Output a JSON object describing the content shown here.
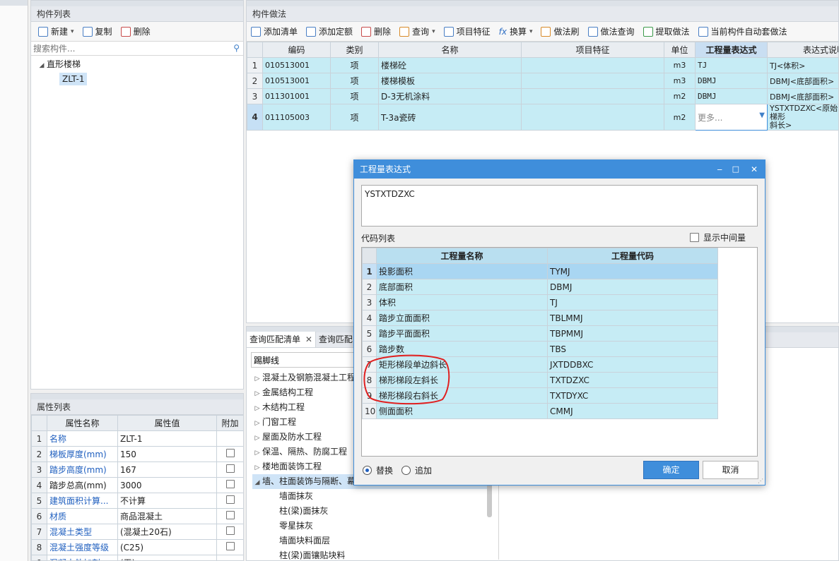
{
  "left_panel": {
    "title": "构件列表",
    "toolbar": {
      "new": "新建",
      "copy": "复制",
      "delete": "删除"
    },
    "search_placeholder": "搜索构件...",
    "tree": {
      "root": "直形楼梯",
      "child": "ZLT-1"
    }
  },
  "props_panel": {
    "title": "属性列表",
    "headers": [
      "属性名称",
      "属性值",
      "附加"
    ],
    "rows": [
      {
        "n": "1",
        "name": "名称",
        "value": "ZLT-1",
        "blue": true,
        "check": false
      },
      {
        "n": "2",
        "name": "梯板厚度(mm)",
        "value": "150",
        "blue": true,
        "check": true
      },
      {
        "n": "3",
        "name": "踏步高度(mm)",
        "value": "167",
        "blue": true,
        "check": true
      },
      {
        "n": "4",
        "name": "踏步总高(mm)",
        "value": "3000",
        "blue": false,
        "check": true
      },
      {
        "n": "5",
        "name": "建筑面积计算...",
        "value": "不计算",
        "blue": true,
        "check": true
      },
      {
        "n": "6",
        "name": "材质",
        "value": "商品混凝土",
        "blue": true,
        "check": true
      },
      {
        "n": "7",
        "name": "混凝土类型",
        "value": "(混凝土20石)",
        "blue": true,
        "check": true
      },
      {
        "n": "8",
        "name": "混凝土强度等级",
        "value": "(C25)",
        "blue": true,
        "check": true
      },
      {
        "n": "9",
        "name": "混凝土外加剂",
        "value": "(无)",
        "blue": true,
        "check": false
      }
    ]
  },
  "method_panel": {
    "title": "构件做法",
    "toolbar": {
      "add_list": "添加清单",
      "add_quota": "添加定额",
      "delete": "删除",
      "query": "查询",
      "item_feature": "项目特征",
      "convert": "换算",
      "method_brush": "做法刷",
      "method_query": "做法查询",
      "extract": "提取做法",
      "auto_apply": "当前构件自动套做法"
    },
    "headers": [
      "编码",
      "类别",
      "名称",
      "项目特征",
      "单位",
      "工程量表达式",
      "表达式说明"
    ],
    "rows": [
      {
        "n": "1",
        "code": "010513001",
        "type": "项",
        "name": "楼梯砼",
        "feature": "",
        "unit": "m3",
        "expr": "TJ",
        "desc": "TJ<体积>"
      },
      {
        "n": "2",
        "code": "010513001",
        "type": "项",
        "name": "楼梯模板",
        "feature": "",
        "unit": "m3",
        "expr": "DBMJ",
        "desc": "DBMJ<底部面积>"
      },
      {
        "n": "3",
        "code": "011301001",
        "type": "项",
        "name": "D-3无机涂料",
        "feature": "",
        "unit": "m2",
        "expr": "DBMJ",
        "desc": "DBMJ<底部面积>"
      },
      {
        "n": "4",
        "code": "011105003",
        "type": "项",
        "name": "T-3a瓷砖",
        "feature": "",
        "unit": "m2",
        "expr": "更多...",
        "desc": "YSTXTDZXC<原始梯形",
        "desc2": "斜长>"
      }
    ]
  },
  "query_panel": {
    "tab1": "查询匹配清单",
    "tab2": "查询匹配",
    "search_value": "踢脚线",
    "tree": [
      {
        "label": "混凝土及钢筋混凝土工程",
        "open": false
      },
      {
        "label": "金属结构工程",
        "open": false
      },
      {
        "label": "木结构工程",
        "open": false
      },
      {
        "label": "门窗工程",
        "open": false
      },
      {
        "label": "屋面及防水工程",
        "open": false
      },
      {
        "label": "保温、隔热、防腐工程",
        "open": false
      },
      {
        "label": "楼地面装饰工程",
        "open": false
      },
      {
        "label": "墙、柱面装饰与隔断、幕",
        "open": true
      }
    ],
    "children": [
      "墙面抹灰",
      "柱(梁)面抹灰",
      "零星抹灰",
      "墙面块料面层",
      "柱(梁)面镶贴块料"
    ]
  },
  "dialog": {
    "title": "工程量表达式",
    "expression": "YSTXTDZXC",
    "code_list_label": "代码列表",
    "show_intermediate": "显示中间量",
    "headers": [
      "工程量名称",
      "工程量代码"
    ],
    "rows": [
      {
        "n": "1",
        "name": "投影面积",
        "code": "TYMJ"
      },
      {
        "n": "2",
        "name": "底部面积",
        "code": "DBMJ"
      },
      {
        "n": "3",
        "name": "体积",
        "code": "TJ"
      },
      {
        "n": "4",
        "name": "踏步立面面积",
        "code": "TBLMMJ"
      },
      {
        "n": "5",
        "name": "踏步平面面积",
        "code": "TBPMMJ"
      },
      {
        "n": "6",
        "name": "踏步数",
        "code": "TBS"
      },
      {
        "n": "7",
        "name": "矩形梯段单边斜长",
        "code": "JXTDDBXC"
      },
      {
        "n": "8",
        "name": "梯形梯段左斜长",
        "code": "TXTDZXC"
      },
      {
        "n": "9",
        "name": "梯形梯段右斜长",
        "code": "TXTDYXC"
      },
      {
        "n": "10",
        "name": "侧面面积",
        "code": "CMMJ"
      }
    ],
    "replace": "替换",
    "append": "追加",
    "ok": "确定",
    "cancel": "取消"
  },
  "colors": {
    "accent": "#3f8edb",
    "row_fill": "#c6ecf5",
    "annotation": "#e02020"
  }
}
